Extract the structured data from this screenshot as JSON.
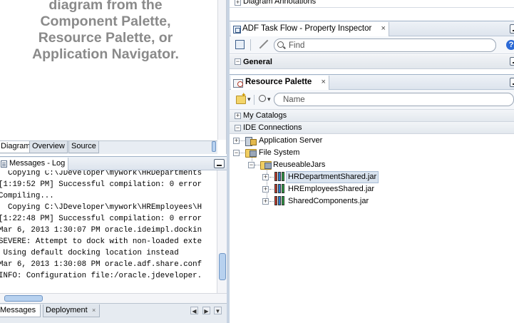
{
  "editor": {
    "empty_message_lines": [
      "diagram from the",
      "Component Palette,",
      "Resource Palette, or",
      "Application Navigator."
    ],
    "tabs": [
      "Diagram",
      "Overview",
      "Source"
    ]
  },
  "log": {
    "title": "Messages - Log",
    "close": "×",
    "lines": [
      "  Copying C:\\JDeveloper\\mywork\\HRDepartments",
      "[1:19:52 PM] Successful compilation: 0 error",
      "Compiling...",
      "  Copying C:\\JDeveloper\\mywork\\HREmployees\\H",
      "[1:22:48 PM] Successful compilation: 0 error",
      "Mar 6, 2013 1:30:07 PM oracle.ideimpl.dockin",
      "SEVERE: Attempt to dock with non-loaded exte",
      " Using default docking location instead",
      "Mar 6, 2013 1:30:08 PM oracle.adf.share.conf",
      "INFO: Configuration file:/oracle.jdeveloper."
    ],
    "tabs": [
      "Messages",
      "Deployment"
    ],
    "tab_close": "×",
    "nav_left": "◀",
    "nav_right": "▶",
    "nav_menu": "▼"
  },
  "inspector": {
    "diagram_annotations": "Diagram Annotations",
    "title": "ADF Task Flow - Property Inspector",
    "close": "×",
    "find_placeholder": "Find",
    "help": "?",
    "section": "General",
    "section_toggle": "−",
    "plus": "+"
  },
  "resource_palette": {
    "title": "Resource Palette",
    "close": "×",
    "search_placeholder": "Name",
    "dropdown_caret": "▾",
    "sections": [
      {
        "label": "My Catalogs",
        "toggle": "+"
      },
      {
        "label": "IDE Connections",
        "toggle": "−"
      }
    ],
    "tree": {
      "application_server": "Application Server",
      "file_system": "File System",
      "reuseable_jars": "ReuseableJars",
      "jars": [
        "HRDepartmentShared.jar",
        "HREmployeesShared.jar",
        "SharedComponents.jar"
      ]
    },
    "toggles": {
      "expand": "+",
      "collapse": "−"
    }
  },
  "colors": {
    "header_border": "#9fb1c7",
    "selection_bg": "#d9e3ef",
    "splitter": "#c7d3e2",
    "muted_text": "#8a8a8a"
  }
}
